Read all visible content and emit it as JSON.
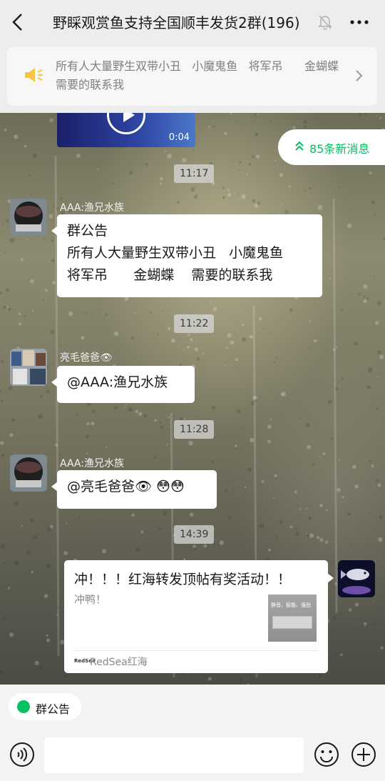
{
  "header": {
    "title": "野睬观赏鱼支持全国顺丰发货2群(196)",
    "back_icon": "back-chevron-icon",
    "mute_icon": "mute-bell-icon",
    "more_icon": "more-dots-icon"
  },
  "notice_bar": {
    "text": "所有人大量野生双带小丑   小魔鬼鱼   将军吊      金蝴蝶   需要的联系我",
    "icon": "speaker-icon",
    "accent": "#f6c544"
  },
  "chat": {
    "video": {
      "duration": "0:04"
    },
    "new_messages": {
      "label": "85条新消息",
      "color": "#07c160"
    },
    "timestamps": [
      "11:17",
      "11:22",
      "11:28",
      "14:39"
    ],
    "messages": [
      {
        "sender": "AAA:渔兄水族",
        "text": "群公告\n所有人大量野生双带小丑   小魔鬼鱼\n将军吊      金蝴蝶    需要的联系我"
      },
      {
        "sender": "亮毛爸爸👁",
        "text": "@AAA:渔兄水族"
      },
      {
        "sender": "AAA:渔兄水族",
        "text": "@亮毛爸爸👁 😳😳"
      }
    ],
    "card": {
      "title": "冲！！！红海转发顶帖有奖活动！！",
      "description": "冲鸭！",
      "thumb_caption": "静音、智能、强劲",
      "source_logo": "RedSea",
      "source": "RedSea红海"
    }
  },
  "notice_chip": {
    "label": "群公告"
  },
  "input_bar": {
    "voice_icon": "voice-icon",
    "emoji_icon": "emoji-icon",
    "plus_icon": "plus-icon"
  }
}
